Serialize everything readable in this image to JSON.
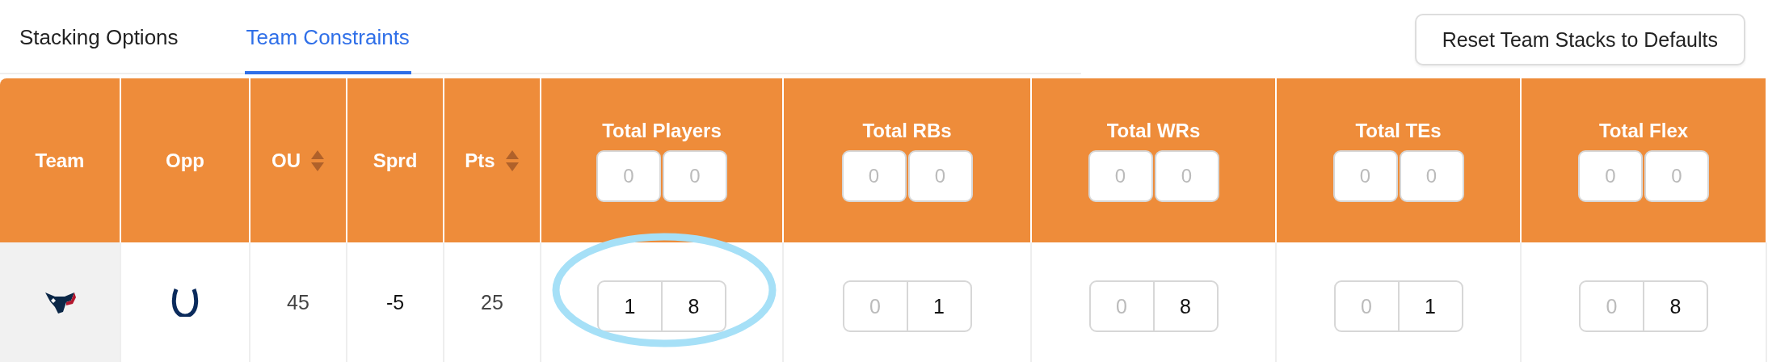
{
  "tabs": [
    {
      "label": "Stacking Options",
      "selected": false
    },
    {
      "label": "Team Constraints",
      "selected": true
    }
  ],
  "reset_button": "Reset Team Stacks to Defaults",
  "table": {
    "columns": [
      {
        "label": "Team",
        "kind": "plain",
        "sortable": false
      },
      {
        "label": "Opp",
        "kind": "plain",
        "sortable": false
      },
      {
        "label": "OU",
        "kind": "plain",
        "sortable": true
      },
      {
        "label": "Sprd",
        "kind": "plain",
        "sortable": false
      },
      {
        "label": "Pts",
        "kind": "plain",
        "sortable": true
      },
      {
        "label": "Total Players",
        "kind": "range",
        "min_placeholder": "0",
        "max_placeholder": "0"
      },
      {
        "label": "Total RBs",
        "kind": "range",
        "min_placeholder": "0",
        "max_placeholder": "0"
      },
      {
        "label": "Total WRs",
        "kind": "range",
        "min_placeholder": "0",
        "max_placeholder": "0"
      },
      {
        "label": "Total TEs",
        "kind": "range",
        "min_placeholder": "0",
        "max_placeholder": "0"
      },
      {
        "label": "Total Flex",
        "kind": "range",
        "min_placeholder": "0",
        "max_placeholder": "0"
      }
    ],
    "rows": [
      {
        "ou": "45",
        "sprd": "-5",
        "pts": "25",
        "ranges": [
          {
            "min": "1",
            "max": "8",
            "highlighted": true
          },
          {
            "min_placeholder": "0",
            "max": "1",
            "highlighted": false
          },
          {
            "min_placeholder": "0",
            "max": "8",
            "highlighted": false
          },
          {
            "min_placeholder": "0",
            "max": "1",
            "highlighted": false
          },
          {
            "min_placeholder": "0",
            "max": "8",
            "highlighted": false
          }
        ]
      }
    ]
  }
}
